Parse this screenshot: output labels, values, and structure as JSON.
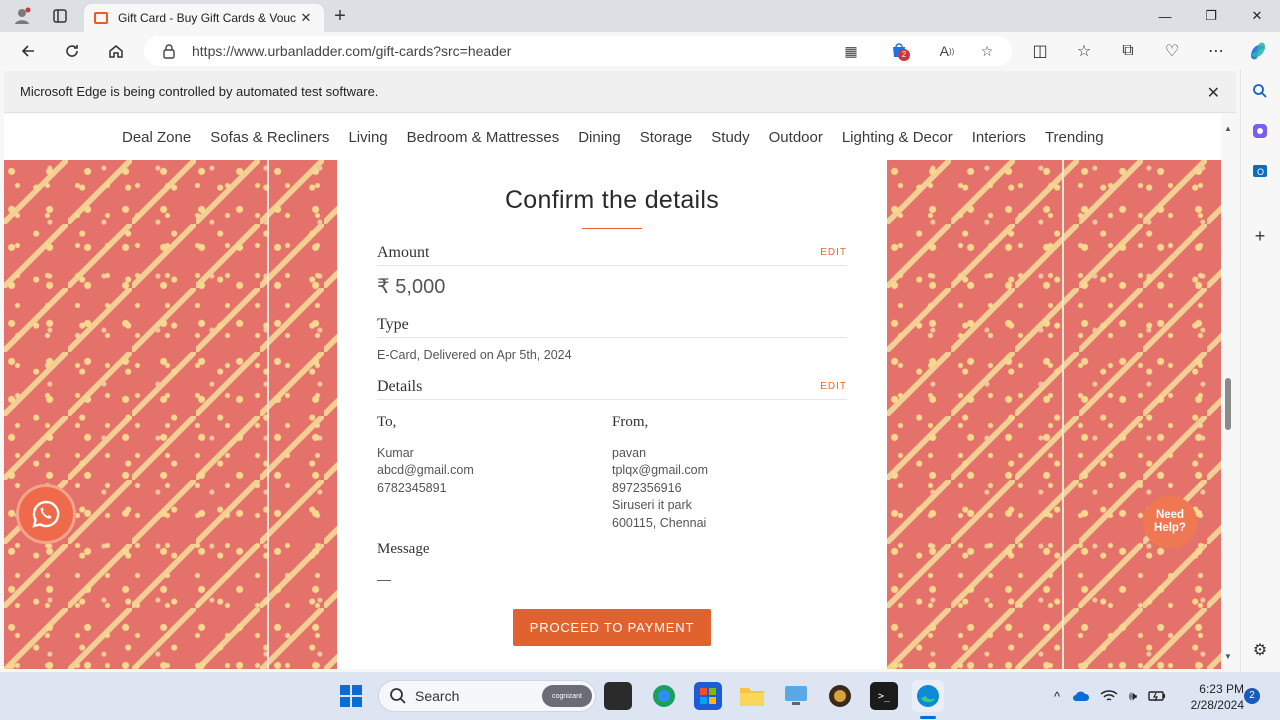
{
  "browser": {
    "tab_title": "Gift Card - Buy Gift Cards & Vouc",
    "url": "https://www.urbanladder.com/gift-cards?src=header",
    "automation_notice": "Microsoft Edge is being controlled by automated test software.",
    "shopping_badge_count": "2"
  },
  "menu": {
    "items": [
      "Deal Zone",
      "Sofas & Recliners",
      "Living",
      "Bedroom & Mattresses",
      "Dining",
      "Storage",
      "Study",
      "Outdoor",
      "Lighting & Decor",
      "Interiors",
      "Trending"
    ]
  },
  "confirm": {
    "title": "Confirm the details",
    "amount_label": "Amount",
    "amount_value": "₹ 5,000",
    "edit_label": "EDIT",
    "type_label": "Type",
    "type_value": "E-Card, Delivered on Apr 5th, 2024",
    "details_label": "Details",
    "to_label": "To,",
    "to_name": "Kumar",
    "to_email": "abcd@gmail.com",
    "to_phone": "6782345891",
    "from_label": "From,",
    "from_name": "pavan",
    "from_email": "tplqx@gmail.com",
    "from_phone": "8972356916",
    "from_address": "Siruseri it park",
    "from_city": "600115, Chennai",
    "message_label": "Message",
    "message_value": "—",
    "proceed_label": "PROCEED TO PAYMENT"
  },
  "floating": {
    "need_help": "Need Help?"
  },
  "taskbar": {
    "search_placeholder": "Search",
    "search_pill": "cognizant",
    "time": "6:23 PM",
    "date": "2/28/2024",
    "notification_count": "2"
  },
  "colors": {
    "accent": "#e0632f",
    "pattern_bg": "#e5716b",
    "pattern_motif": "#f6d98f"
  }
}
